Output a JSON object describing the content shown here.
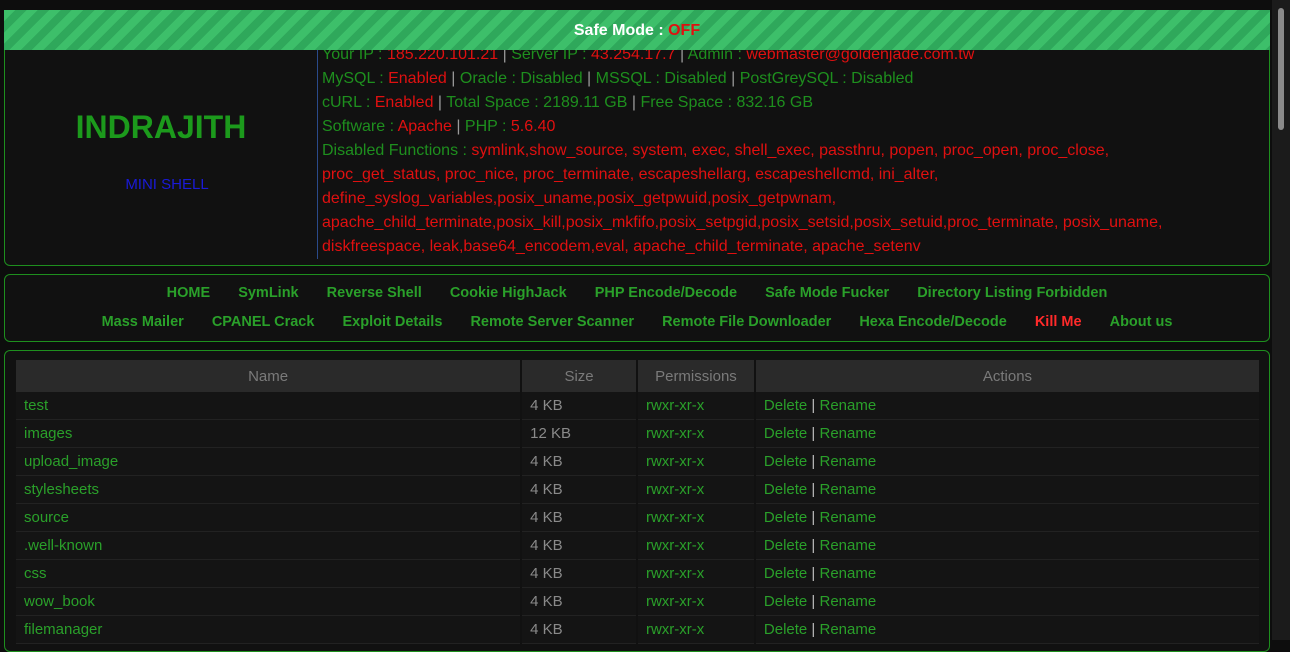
{
  "safe_mode": {
    "label": "Safe Mode : ",
    "value": "OFF"
  },
  "brand": {
    "title": "INDRAJITH",
    "subtitle": "MINI SHELL"
  },
  "info": {
    "your_ip_label": "Your IP : ",
    "your_ip": "185.220.101.21",
    "server_ip_label": "Server IP : ",
    "server_ip": "43.254.17.7",
    "admin_label": "Admin : ",
    "admin": "webmaster@goldenjade.com.tw",
    "mysql_label": "MySQL : ",
    "mysql": "Enabled",
    "oracle_label": "Oracle : Disabled",
    "mssql_label": "MSSQL : Disabled",
    "pgsql_label": "PostGreySQL : Disabled",
    "curl_label": "cURL : ",
    "curl": "Enabled",
    "total_space": "Total Space : 2189.11 GB",
    "free_space": "Free Space : 832.16 GB",
    "software_label": "Software : ",
    "software": "Apache",
    "php_label": "PHP : ",
    "php": "5.6.40",
    "disabled_label": "Disabled Functions : ",
    "disabled_lines": [
      "symlink,show_source, system, exec, shell_exec, passthru, popen, proc_open, proc_close,",
      "proc_get_status, proc_nice, proc_terminate, escapeshellarg, escapeshellcmd, ini_alter,",
      "define_syslog_variables,posix_uname,posix_getpwuid,posix_getpwnam,",
      "apache_child_terminate,posix_kill,posix_mkfifo,posix_setpgid,posix_setsid,posix_setuid,proc_terminate, posix_uname,",
      "diskfreespace, leak,base64_encodem,eval, apache_child_terminate, apache_setenv"
    ]
  },
  "menu": {
    "row1": [
      "HOME",
      "SymLink",
      "Reverse Shell",
      "Cookie HighJack",
      "PHP Encode/Decode",
      "Safe Mode Fucker",
      "Directory Listing Forbidden"
    ],
    "row2": [
      "Mass Mailer",
      "CPANEL Crack",
      "Exploit Details",
      "Remote Server Scanner",
      "Remote File Downloader",
      "Hexa Encode/Decode",
      "Kill Me",
      "About us"
    ]
  },
  "table": {
    "headers": [
      "Name",
      "Size",
      "Permissions",
      "Actions"
    ],
    "delete_label": "Delete",
    "rename_label": "Rename",
    "rows": [
      {
        "name": "test",
        "size": "4 KB",
        "perm": "rwxr-xr-x"
      },
      {
        "name": "images",
        "size": "12 KB",
        "perm": "rwxr-xr-x"
      },
      {
        "name": "upload_image",
        "size": "4 KB",
        "perm": "rwxr-xr-x"
      },
      {
        "name": "stylesheets",
        "size": "4 KB",
        "perm": "rwxr-xr-x"
      },
      {
        "name": "source",
        "size": "4 KB",
        "perm": "rwxr-xr-x"
      },
      {
        "name": ".well-known",
        "size": "4 KB",
        "perm": "rwxr-xr-x"
      },
      {
        "name": "css",
        "size": "4 KB",
        "perm": "rwxr-xr-x"
      },
      {
        "name": "wow_book",
        "size": "4 KB",
        "perm": "rwxr-xr-x"
      },
      {
        "name": "filemanager",
        "size": "4 KB",
        "perm": "rwxr-xr-x"
      }
    ]
  }
}
